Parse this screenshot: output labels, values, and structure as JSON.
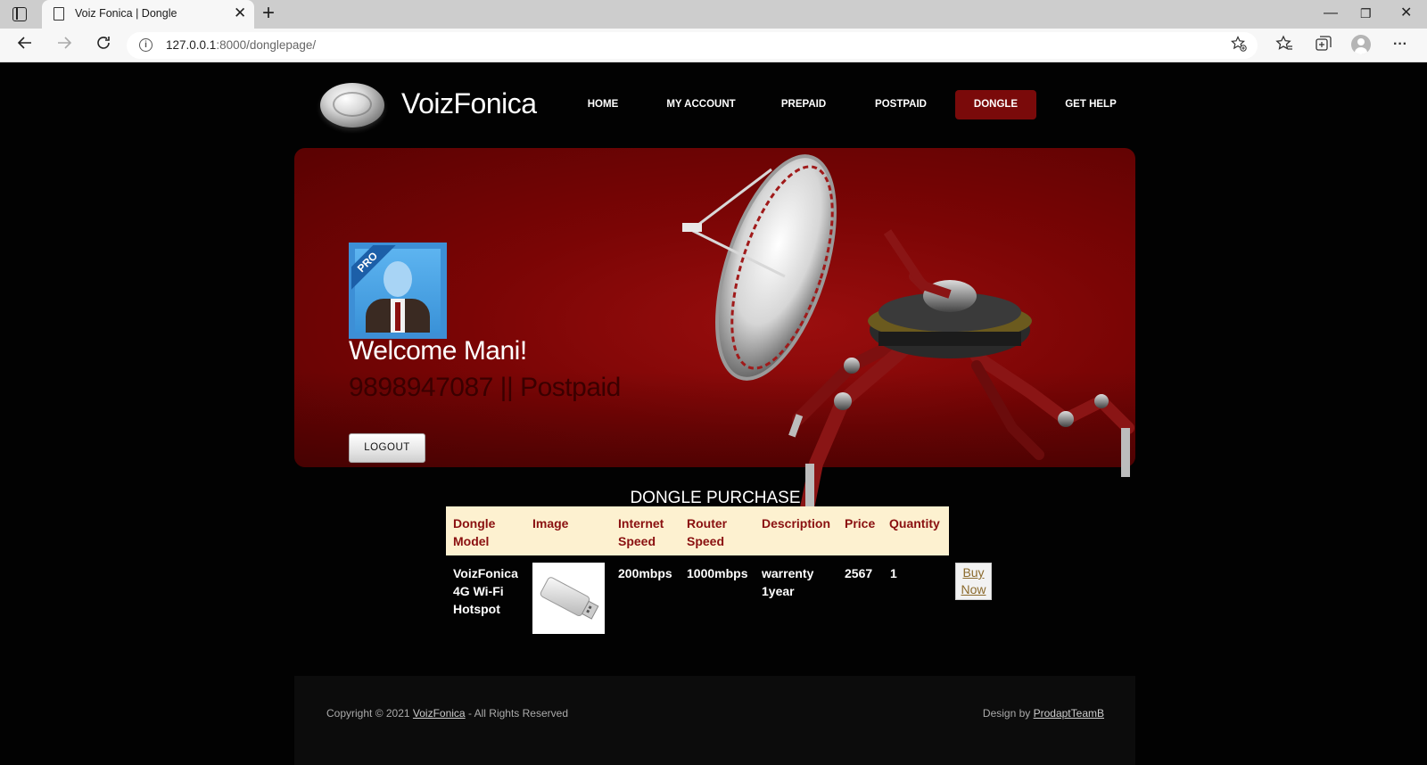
{
  "browser": {
    "tab_title": "Voiz Fonica | Dongle",
    "tab_close": "✕",
    "new_tab": "+",
    "url_host": "127.0.0.1",
    "url_path": ":8000/donglepage/",
    "win_minimize": "—",
    "win_restore": "❐",
    "win_close": "✕",
    "icons": [
      "back-arrow-icon",
      "forward-arrow-icon",
      "reload-icon",
      "info-icon",
      "add-favorite-icon",
      "favorites-icon",
      "collections-icon",
      "profile-icon",
      "more-icon"
    ]
  },
  "header": {
    "logo_text": "VoizFonica",
    "nav": [
      {
        "label": "HOME",
        "active": false
      },
      {
        "label": "MY ACCOUNT",
        "active": false
      },
      {
        "label": "PREPAID",
        "active": false
      },
      {
        "label": "POSTPAID",
        "active": false
      },
      {
        "label": "DONGLE",
        "active": true
      },
      {
        "label": "GET HELP",
        "active": false
      }
    ]
  },
  "banner": {
    "profile_badge": "PRO",
    "welcome": "Welcome Mani!",
    "phone_plan": "9898947087 || Postpaid",
    "logout_label": "LOGOUT"
  },
  "purchase": {
    "title": "DONGLE PURCHASE",
    "headers": {
      "model": [
        "Dongle",
        "Model"
      ],
      "image": "Image",
      "internet": [
        "Internet",
        "Speed"
      ],
      "router": [
        "Router",
        "Speed"
      ],
      "description": "Description",
      "price": "Price",
      "quantity": "Quantity"
    },
    "row": {
      "model": [
        "VoizFonica",
        "4G Wi-Fi",
        "Hotspot"
      ],
      "internet": "200mbps",
      "router": "1000mbps",
      "description": [
        "warrenty",
        "1year"
      ],
      "price": "2567",
      "quantity": "1",
      "buy": [
        "Buy",
        "Now"
      ]
    }
  },
  "footer": {
    "copyright_prefix": "Copyright © 2021 ",
    "brand_link": "VoizFonica",
    "copyright_suffix": " - All Rights Reserved",
    "design_prefix": "Design by ",
    "design_link": "ProdaptTeamB"
  },
  "colors": {
    "accent_red": "#7a0a0a",
    "table_header_bg": "#fdf1d0",
    "table_header_text": "#8a1010",
    "link_brown": "#8b6a2c"
  }
}
